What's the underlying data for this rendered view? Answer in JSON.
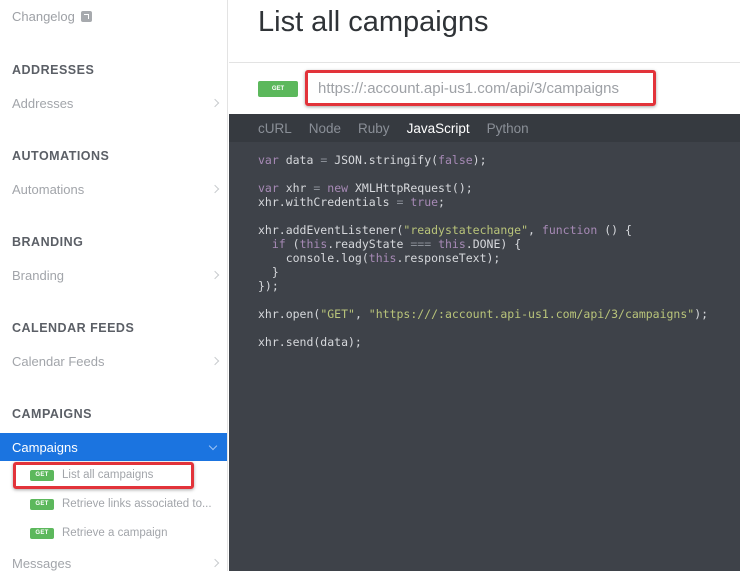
{
  "sidebar": {
    "changelog_label": "Changelog",
    "sections": [
      {
        "heading": "ADDRESSES",
        "item": "Addresses"
      },
      {
        "heading": "AUTOMATIONS",
        "item": "Automations"
      },
      {
        "heading": "BRANDING",
        "item": "Branding"
      },
      {
        "heading": "CALENDAR FEEDS",
        "item": "Calendar Feeds"
      },
      {
        "heading": "CAMPAIGNS",
        "item": "Campaigns"
      }
    ],
    "sub_items": [
      {
        "method": "GET",
        "label": "List all campaigns"
      },
      {
        "method": "GET",
        "label": "Retrieve links associated to..."
      },
      {
        "method": "GET",
        "label": "Retrieve a campaign"
      }
    ],
    "next_item": "Messages"
  },
  "main": {
    "title": "List all campaigns",
    "method": "GET",
    "url": "https://:account.api-us1.com/api/3/campaigns",
    "tabs": [
      "cURL",
      "Node",
      "Ruby",
      "JavaScript",
      "Python"
    ],
    "active_tab": "JavaScript",
    "code": {
      "l1_var": "var",
      "l1_a": " data ",
      "l1_eq": "=",
      "l1_b": " JSON.stringify(",
      "l1_false": "false",
      "l1_c": ");",
      "l2_var": "var",
      "l2_a": " xhr ",
      "l2_eq": "=",
      "l2_new": " new",
      "l2_b": " XMLHttpRequest();",
      "l3_a": "xhr.withCredentials ",
      "l3_eq": "=",
      "l3_true": " true",
      "l3_b": ";",
      "l4_a": "xhr.addEventListener(",
      "l4_str": "\"readystatechange\"",
      "l4_b": ", ",
      "l4_fn": "function",
      "l4_c": " () {",
      "l5_if": "  if",
      "l5_a": " (",
      "l5_this1": "this",
      "l5_b": ".readyState ",
      "l5_eq": "===",
      "l5_this2": " this",
      "l5_c": ".DONE) {",
      "l6_a": "    console.log(",
      "l6_this": "this",
      "l6_b": ".responseText);",
      "l7": "  }",
      "l8": "});",
      "l9_a": "xhr.open(",
      "l9_s1": "\"GET\"",
      "l9_b": ", ",
      "l9_s2": "\"https:///:account.api-us1.com/api/3/campaigns\"",
      "l9_c": ");",
      "l10": "xhr.send(data);"
    }
  }
}
